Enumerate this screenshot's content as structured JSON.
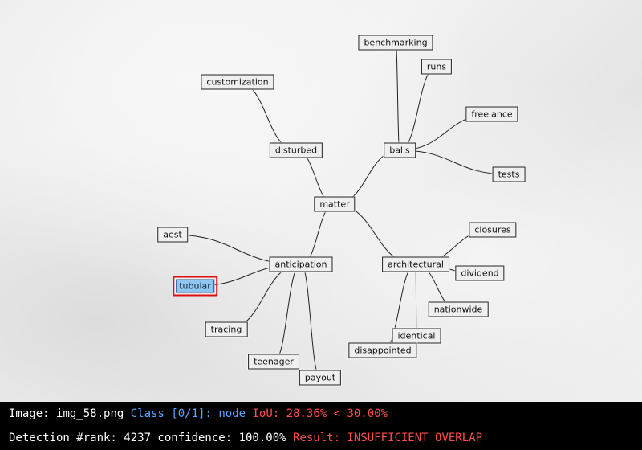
{
  "diagram": {
    "edge_color": "#222222",
    "nodes": [
      {
        "id": "matter",
        "label": "matter"
      },
      {
        "id": "disturbed",
        "label": "disturbed"
      },
      {
        "id": "customization",
        "label": "customization"
      },
      {
        "id": "balls",
        "label": "balls"
      },
      {
        "id": "benchmarking",
        "label": "benchmarking"
      },
      {
        "id": "runs",
        "label": "runs"
      },
      {
        "id": "freelance",
        "label": "freelance"
      },
      {
        "id": "tests",
        "label": "tests"
      },
      {
        "id": "anticipation",
        "label": "anticipation"
      },
      {
        "id": "aest",
        "label": "aest"
      },
      {
        "id": "tubular",
        "label": "tubular",
        "selected": true
      },
      {
        "id": "tracing",
        "label": "tracing"
      },
      {
        "id": "teenager",
        "label": "teenager"
      },
      {
        "id": "payout",
        "label": "payout"
      },
      {
        "id": "architectural",
        "label": "architectural"
      },
      {
        "id": "closures",
        "label": "closures"
      },
      {
        "id": "dividend",
        "label": "dividend"
      },
      {
        "id": "nationwide",
        "label": "nationwide"
      },
      {
        "id": "identical",
        "label": "identical"
      },
      {
        "id": "disappointed",
        "label": "disappointed"
      }
    ],
    "edges": [
      [
        "matter",
        "disturbed"
      ],
      [
        "disturbed",
        "customization"
      ],
      [
        "matter",
        "balls"
      ],
      [
        "balls",
        "benchmarking"
      ],
      [
        "balls",
        "runs"
      ],
      [
        "balls",
        "freelance"
      ],
      [
        "balls",
        "tests"
      ],
      [
        "matter",
        "anticipation"
      ],
      [
        "anticipation",
        "aest"
      ],
      [
        "anticipation",
        "tubular"
      ],
      [
        "anticipation",
        "tracing"
      ],
      [
        "anticipation",
        "teenager"
      ],
      [
        "anticipation",
        "payout"
      ],
      [
        "matter",
        "architectural"
      ],
      [
        "architectural",
        "closures"
      ],
      [
        "architectural",
        "dividend"
      ],
      [
        "architectural",
        "nationwide"
      ],
      [
        "architectural",
        "identical"
      ],
      [
        "architectural",
        "disappointed"
      ]
    ]
  },
  "status": {
    "image_label": "Image:",
    "image_name": "img_58.png",
    "class_text": "Class [0/1]:",
    "class_name": "node",
    "iou_text": "IoU: 28.36% < 30.00%",
    "rank_text": "Detection #rank: 4237 confidence: 100.00%",
    "result_text": "Result: INSUFFICIENT OVERLAP",
    "colors": {
      "text": "#ffffff",
      "info": "#5aa6ff",
      "alert": "#ff4d4d"
    }
  }
}
